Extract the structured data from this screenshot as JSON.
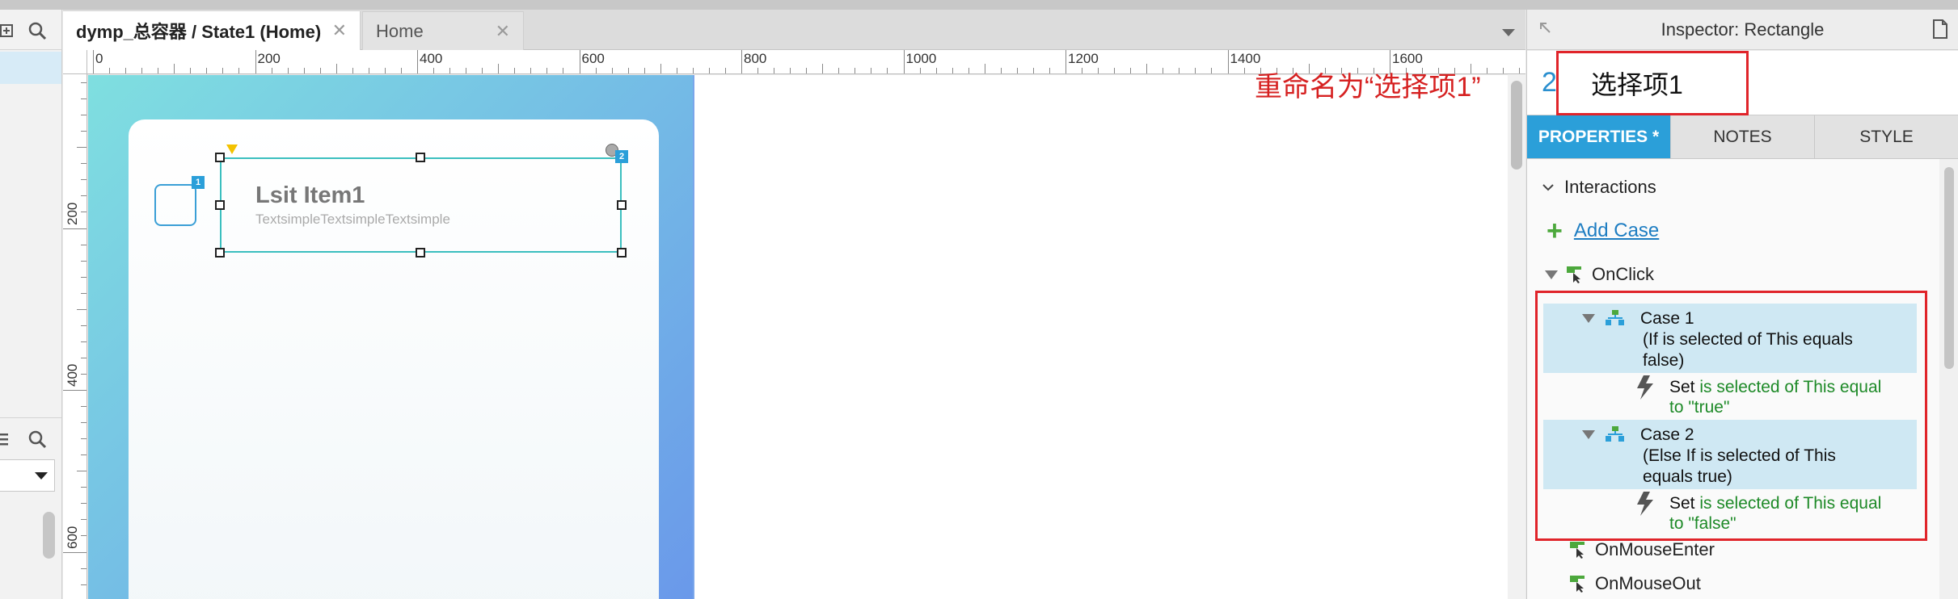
{
  "editor": {
    "tabs": [
      {
        "label": "dymp_总容器 / State1 (Home)",
        "active": true
      },
      {
        "label": "Home",
        "active": false
      }
    ],
    "ruler_h": [
      "0",
      "200",
      "400",
      "600",
      "800",
      "1000",
      "1200",
      "1400",
      "1600"
    ],
    "ruler_v": [
      "200",
      "400",
      "600"
    ],
    "widget": {
      "title": "Lsit Item1",
      "subtitle": "TextsimpleTextsimpleTextsimple",
      "badge_checkbox": "1",
      "badge_rect": "2"
    }
  },
  "annotation": {
    "text": "重命名为“选择项1”",
    "color": "#d62121"
  },
  "inspector": {
    "title": "Inspector: Rectangle",
    "name_prefix": "2",
    "name_value": "选择项1",
    "tabs": [
      {
        "label": "PROPERTIES *",
        "active": true
      },
      {
        "label": "NOTES",
        "active": false
      },
      {
        "label": "STYLE",
        "active": false
      }
    ],
    "section": "Interactions",
    "add_case": "Add Case",
    "events": {
      "onclick": "OnClick",
      "onmouseenter": "OnMouseEnter",
      "onmouseout": "OnMouseOut"
    },
    "cases": [
      {
        "title": "Case 1",
        "condition_1": "(If is selected of This equals",
        "condition_2": "false)",
        "action_verb": "Set",
        "action_1": "is selected of This equal",
        "action_2": "to \"true\""
      },
      {
        "title": "Case 2",
        "condition_1": "(Else If is selected of This",
        "condition_2": "equals true)",
        "action_verb": "Set",
        "action_1": "is selected of This equal",
        "action_2": "to \"false\""
      }
    ]
  },
  "colors": {
    "accent": "#2b9fd9",
    "highlight_red": "#e0242a",
    "action_green": "#1e8a28",
    "case_bg": "#cfe8f3"
  }
}
